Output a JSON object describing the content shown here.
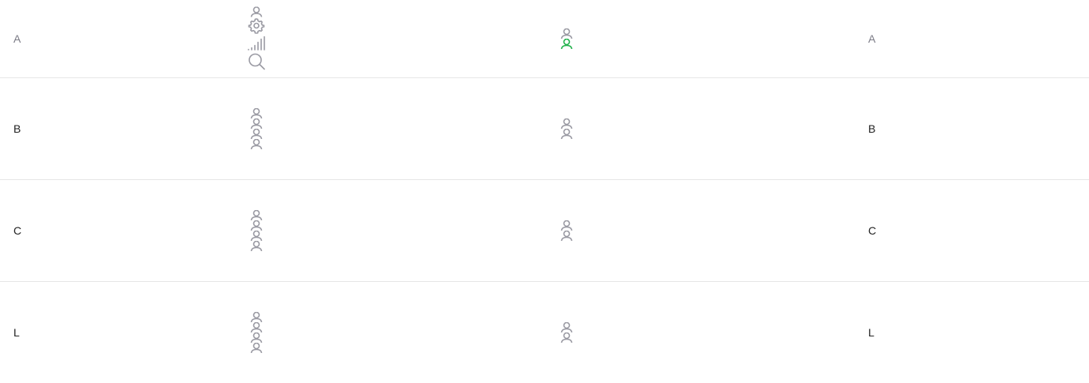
{
  "rows": [
    {
      "label_left": "A",
      "label_right": "A",
      "left_icons": [
        "person-icon",
        "gear-icon",
        "signal-icon",
        "search-icon"
      ],
      "right_icons": [
        "person-icon",
        "person-icon-active"
      ]
    },
    {
      "label_left": "B",
      "label_right": "B",
      "left_icons": [
        "person-icon",
        "person-icon",
        "person-icon",
        "person-icon"
      ],
      "right_icons": [
        "person-icon",
        "person-icon"
      ]
    },
    {
      "label_left": "C",
      "label_right": "C",
      "left_icons": [
        "person-icon",
        "person-icon",
        "person-icon",
        "person-icon"
      ],
      "right_icons": [
        "person-icon",
        "person-icon"
      ]
    },
    {
      "label_left": "L",
      "label_right": "L",
      "left_icons": [
        "person-icon",
        "person-icon",
        "person-icon",
        "person-icon"
      ],
      "right_icons": [
        "person-icon",
        "person-icon"
      ]
    }
  ],
  "colors": {
    "icon_gray": "#9a9aa3",
    "icon_active": "#22b14c",
    "text_muted": "#7b7b86",
    "text": "#222222",
    "divider": "#e6e6e6"
  }
}
